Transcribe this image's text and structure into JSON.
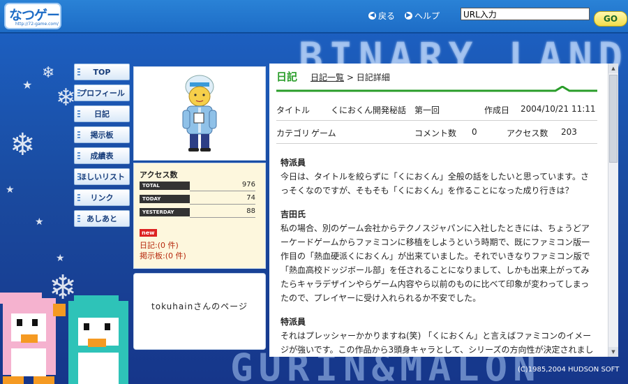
{
  "header": {
    "logo_text": "なつゲー",
    "logo_url": "http://72-game.com/",
    "back_label": "戻る",
    "help_label": "ヘルプ",
    "url_input_value": "URL入力",
    "go_label": "GO"
  },
  "background": {
    "top_text": "BINARY LAND",
    "bottom_text": "GURIN&MALON"
  },
  "menu": {
    "items": [
      {
        "label": "TOP"
      },
      {
        "label": "プロフィール"
      },
      {
        "label": "日記"
      },
      {
        "label": "掲示板"
      },
      {
        "label": "成績表"
      },
      {
        "label": "ほしいリスト"
      },
      {
        "label": "リンク"
      },
      {
        "label": "あしあと"
      }
    ]
  },
  "access": {
    "title": "アクセス数",
    "rows": [
      {
        "label": "TOTAL",
        "value": "976"
      },
      {
        "label": "TODAY",
        "value": "74"
      },
      {
        "label": "YESTERDAY",
        "value": "88"
      }
    ],
    "new_badge": "new",
    "diary_count": "日記:(0 件)",
    "bbs_count": "掲示板:(0 件)"
  },
  "owner": {
    "text": "tokuhainさんのページ"
  },
  "diary": {
    "heading": "日記",
    "breadcrumb_list": "日記一覧",
    "breadcrumb_sep": ">",
    "breadcrumb_current": "日記詳細",
    "title_label": "タイトル",
    "title_value": "くにおくん開発秘話　第一回",
    "created_label": "作成日",
    "created_value": "2004/10/21 11:11",
    "category_label": "カテゴリ",
    "category_value": "ゲーム",
    "comment_label": "コメント数",
    "comment_value": "0",
    "access_label": "アクセス数",
    "access_value": "203",
    "paragraphs": [
      {
        "speaker": "特派員",
        "text": "今日は、タイトルを絞らずに「くにおくん」全般の話をしたいと思っています。さっそくなのですが、そもそも「くにおくん」を作ることになった成り行きは？"
      },
      {
        "speaker": "吉田氏",
        "text": "私の場合、別のゲーム会社からテクノスジャパンに入社したときには、ちょうどアーケードゲームからファミコンに移植をしようという時期で、既にファミコン版一作目の「熱血硬派くにおくん」が出来ていました。それでいきなりファミコン版で「熱血高校ドッジボール部」を任されることになりまして、しかも出来上がってみたらキャラデザインやらゲーム内容やら以前のものに比べて印象が変わってしまったので、プレイヤーに受け入れられるか不安でした。"
      },
      {
        "speaker": "特派員",
        "text": "それはプレッシャーかかりますね(笑) 「くにおくん」と言えばファミコンのイメージが強いです。この作品から3頭身キャラとして、シリーズの方向性が決定されましたけれ、キャラ"
      }
    ]
  },
  "copyright": "(C)1985,2004 HUDSON SOFT",
  "colors": {
    "header_blue": "#1d6cc6",
    "accent_green": "#2a9d2a",
    "count_red": "#b6270c"
  }
}
